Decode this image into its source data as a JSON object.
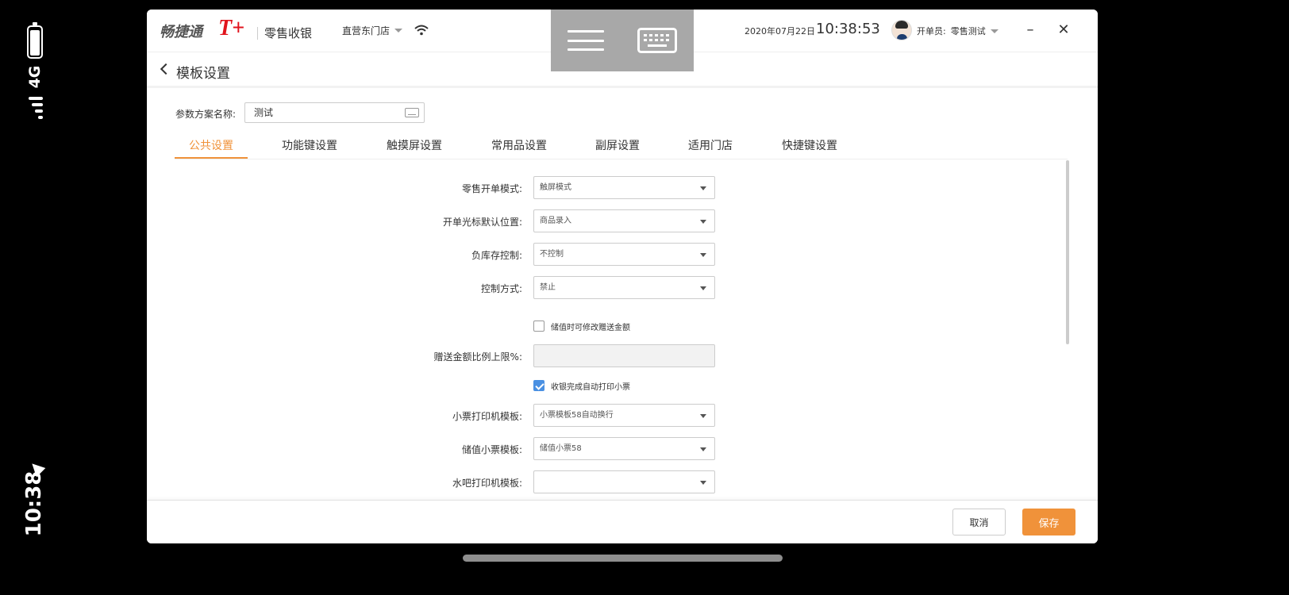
{
  "phone_status": {
    "network": "4G",
    "time": "10:38"
  },
  "header": {
    "brand_name": "畅捷通",
    "brand_mark": "T+",
    "product": "零售收银",
    "store": "直营东门店",
    "date": "2020年07月22日",
    "time": "10:38:53",
    "operator_label": "开单员:",
    "operator_name": "零售测试",
    "minimize_symbol": "–",
    "close_symbol": "✕"
  },
  "page": {
    "title": "模板设置",
    "scheme_label": "参数方案名称:",
    "scheme_value": "测试"
  },
  "tabs": [
    {
      "label": "公共设置",
      "active": true
    },
    {
      "label": "功能键设置",
      "active": false
    },
    {
      "label": "触摸屏设置",
      "active": false
    },
    {
      "label": "常用品设置",
      "active": false
    },
    {
      "label": "副屏设置",
      "active": false
    },
    {
      "label": "适用门店",
      "active": false
    },
    {
      "label": "快捷键设置",
      "active": false
    }
  ],
  "form": {
    "retail_mode": {
      "label": "零售开单模式:",
      "value": "触屏模式"
    },
    "cursor_position": {
      "label": "开单光标默认位置:",
      "value": "商品录入"
    },
    "negative_stock": {
      "label": "负库存控制:",
      "value": "不控制"
    },
    "control_mode": {
      "label": "控制方式:",
      "value": "禁止"
    },
    "modify_gift": {
      "label": "储值时可修改赠送金额",
      "checked": false
    },
    "gift_ratio": {
      "label": "赠送金额比例上限%:",
      "value": ""
    },
    "auto_print": {
      "label": "收银完成自动打印小票",
      "checked": true
    },
    "receipt_template": {
      "label": "小票打印机模板:",
      "value": "小票模板58自动换行"
    },
    "stored_value_template": {
      "label": "储值小票模板:",
      "value": "储值小票58"
    },
    "bar_template": {
      "label": "水吧打印机模板:",
      "value": ""
    }
  },
  "footer": {
    "cancel_label": "取消",
    "save_label": "保存"
  },
  "colors": {
    "accent": "#f0923a",
    "brand_red": "#e1141d",
    "checkbox_checked": "#4a90e2",
    "overlay_panel": "#a8a8a8"
  },
  "icons": [
    "battery-icon",
    "signal-icon",
    "location-arrow-icon",
    "wifi-icon",
    "menu-icon",
    "keyboard-icon",
    "caret-down-icon",
    "back-chevron-icon",
    "close-icon",
    "minimize-icon",
    "avatar"
  ]
}
